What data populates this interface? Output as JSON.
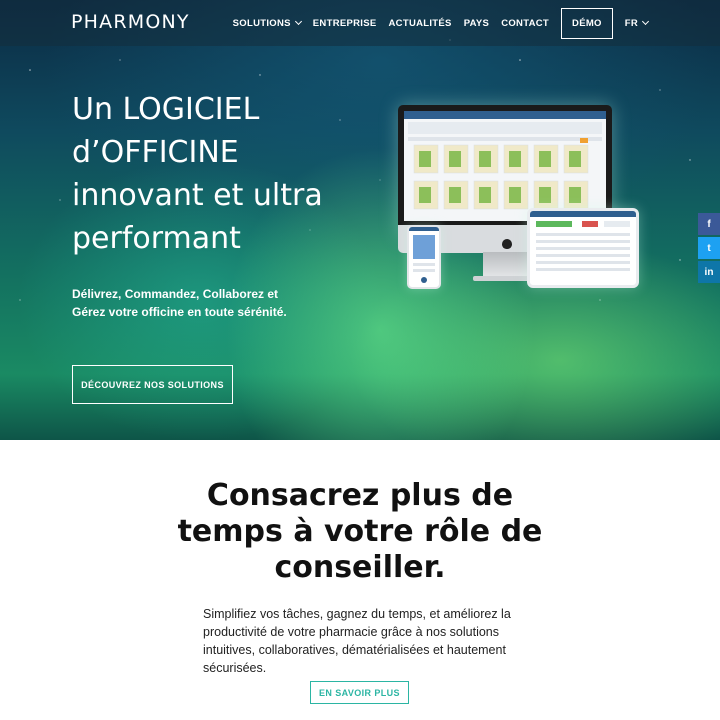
{
  "brand": {
    "logo": "PHARMONY"
  },
  "nav": {
    "items": [
      {
        "label": "SOLUTIONS",
        "has_dropdown": true
      },
      {
        "label": "ENTREPRISE",
        "has_dropdown": false
      },
      {
        "label": "ACTUALITÉS",
        "has_dropdown": false
      },
      {
        "label": "PAYS",
        "has_dropdown": false
      },
      {
        "label": "CONTACT",
        "has_dropdown": false
      }
    ],
    "demo_label": "DÉMO",
    "language": "FR"
  },
  "hero": {
    "title": "Un LOGICIEL d’OFFICINE innovant et ultra performant",
    "subtitle": "Délivrez, Commandez, Collaborez et Gérez votre officine en toute sérénité.",
    "cta_label": "DÉCOUVREZ NOS SOLUTIONS"
  },
  "social": {
    "facebook": "f",
    "twitter": "t",
    "linkedin": "in"
  },
  "section": {
    "title": "Consacrez plus de temps à votre rôle de conseiller.",
    "text": "Simplifiez vos tâches, gagnez du temps, et améliorez la productivité de votre pharmacie grâce à nos solutions intuitives, collaboratives, dématérialisées et hautement sécurisées.",
    "button_label": "EN SAVOIR PLUS"
  },
  "colors": {
    "accent": "#2bb5a3",
    "facebook": "#3b5998",
    "twitter": "#1da1f2",
    "linkedin": "#0e76a8"
  }
}
